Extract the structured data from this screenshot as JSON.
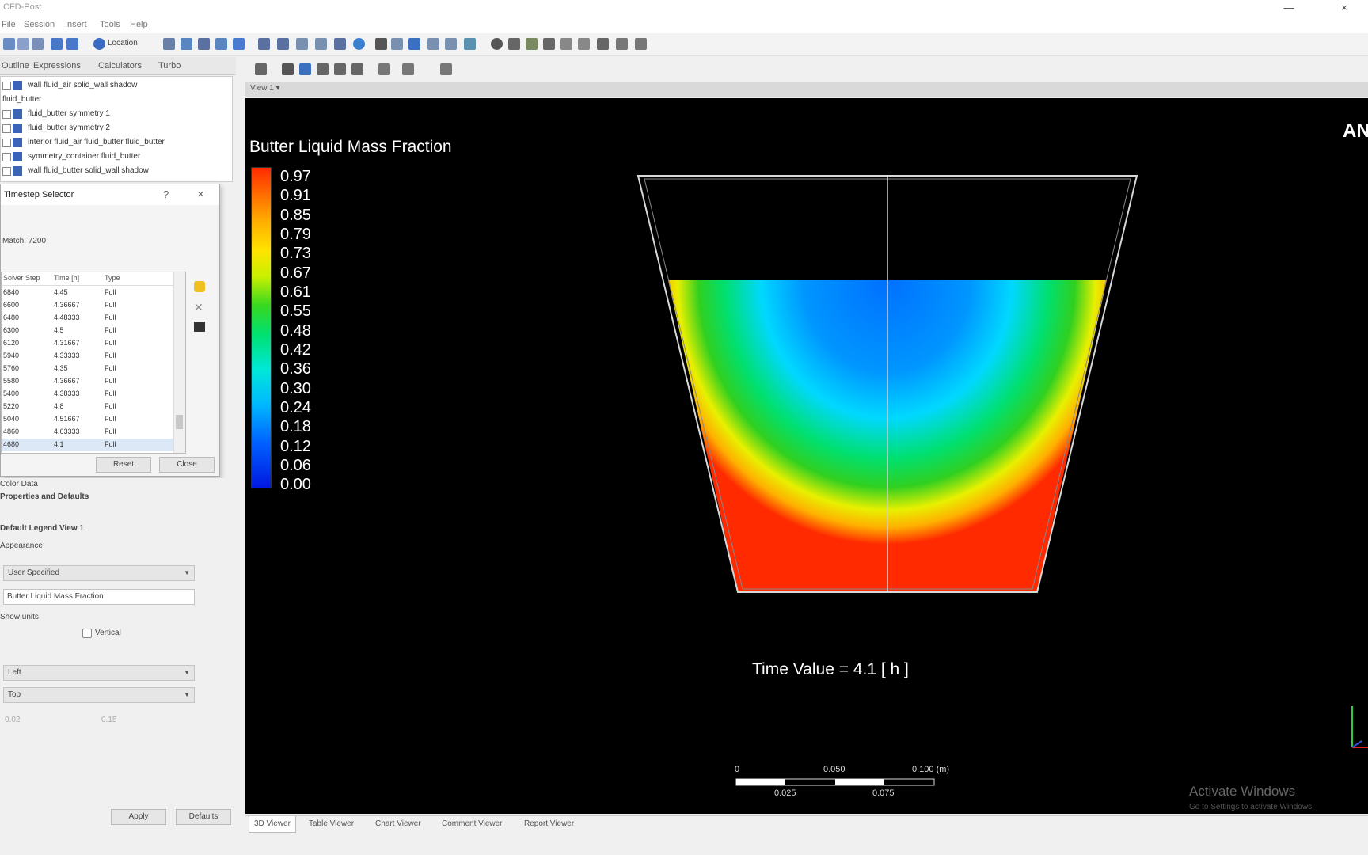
{
  "window": {
    "title": "CFD-Post"
  },
  "menu": [
    "File",
    "Session",
    "Insert",
    "Tools",
    "Help"
  ],
  "toolbar": {
    "location_label": "Location"
  },
  "left_tabs": [
    "Outline",
    "Expressions",
    "Calculators",
    "Turbo"
  ],
  "tree_items": [
    "wall fluid_air solid_wall shadow",
    "fluid_butter",
    "fluid_butter symmetry 1",
    "fluid_butter symmetry 2",
    "interior fluid_air fluid_butter fluid_butter",
    "symmetry_container fluid_butter",
    "wall fluid_butter solid_wall shadow"
  ],
  "timestep_dialog": {
    "title": "Timestep Selector",
    "help": "?",
    "close_x": "×",
    "match_label": "Match: 7200",
    "columns": [
      "Solver Step",
      "Time [h]",
      "Type"
    ],
    "rows": [
      [
        "6840",
        "4.45",
        "Full"
      ],
      [
        "6600",
        "4.36667",
        "Full"
      ],
      [
        "6480",
        "4.48333",
        "Full"
      ],
      [
        "6300",
        "4.5",
        "Full"
      ],
      [
        "6120",
        "4.31667",
        "Full"
      ],
      [
        "5940",
        "4.33333",
        "Full"
      ],
      [
        "5760",
        "4.35",
        "Full"
      ],
      [
        "5580",
        "4.36667",
        "Full"
      ],
      [
        "5400",
        "4.38333",
        "Full"
      ],
      [
        "5220",
        "4.8",
        "Full"
      ],
      [
        "5040",
        "4.51667",
        "Full"
      ],
      [
        "4860",
        "4.63333",
        "Full"
      ],
      [
        "4680",
        "4.1",
        "Full"
      ]
    ],
    "reset_label": "Reset",
    "close_label": "Close"
  },
  "details": {
    "line1": "Color Data",
    "line2": "Properties and Defaults",
    "section": "Default Legend View 1",
    "appearance": "Appearance",
    "title_mode": "User Specified",
    "title_value": "Butter Liquid Mass Fraction",
    "show_units": "Show units",
    "vertical": "Vertical",
    "location_x": "Left",
    "location_y": "Top",
    "xval": "0.02",
    "yval": "0.15",
    "apply": "Apply",
    "defaults": "Defaults"
  },
  "view": {
    "header": "View 1 ▾",
    "brand": "AN",
    "legend_title": "Butter Liquid Mass Fraction",
    "ticks": [
      "0.97",
      "0.91",
      "0.85",
      "0.79",
      "0.73",
      "0.67",
      "0.61",
      "0.55",
      "0.48",
      "0.42",
      "0.36",
      "0.30",
      "0.24",
      "0.18",
      "0.12",
      "0.06",
      "0.00"
    ],
    "time_value": "Time Value = 4.1 [ h ]",
    "scale_top": [
      "0",
      "0.050",
      "0.100 (m)"
    ],
    "scale_bottom": [
      "0.025",
      "0.075"
    ],
    "watermark_title": "Activate Windows",
    "watermark_sub": "Go to Settings to activate Windows."
  },
  "bottom_tabs": [
    "3D Viewer",
    "Table Viewer",
    "Chart Viewer",
    "Comment Viewer",
    "Report Viewer"
  ],
  "colors": {
    "background": "#000000",
    "hot": "#ff2a00",
    "cold": "#0060ff"
  }
}
